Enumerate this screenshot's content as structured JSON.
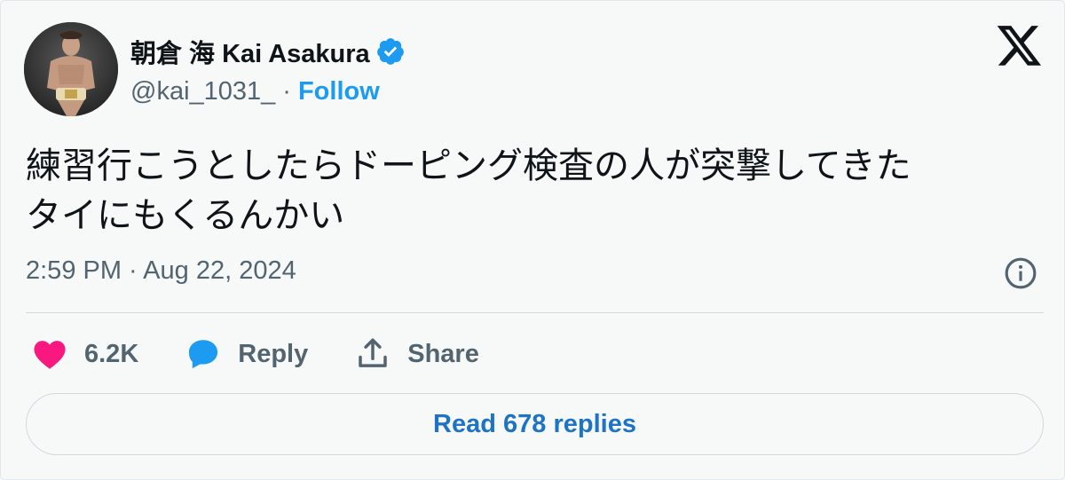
{
  "author": {
    "name": "朝倉 海 Kai Asakura",
    "handle": "@kai_1031_",
    "separator": "·",
    "follow_label": "Follow",
    "verified_icon": "verified-badge-icon"
  },
  "tweet": {
    "lines": [
      "練習行こうとしたらドーピング検査の人が突撃してきた",
      "タイにもくるんかい"
    ],
    "timestamp": "2:59 PM · Aug 22, 2024"
  },
  "actions": {
    "like_count": "6.2K",
    "reply_label": "Reply",
    "share_label": "Share"
  },
  "read_replies_label": "Read 678 replies",
  "colors": {
    "accent": "#1d9bf0",
    "like": "#f91880",
    "text": "#0f1419",
    "muted": "#536471"
  }
}
